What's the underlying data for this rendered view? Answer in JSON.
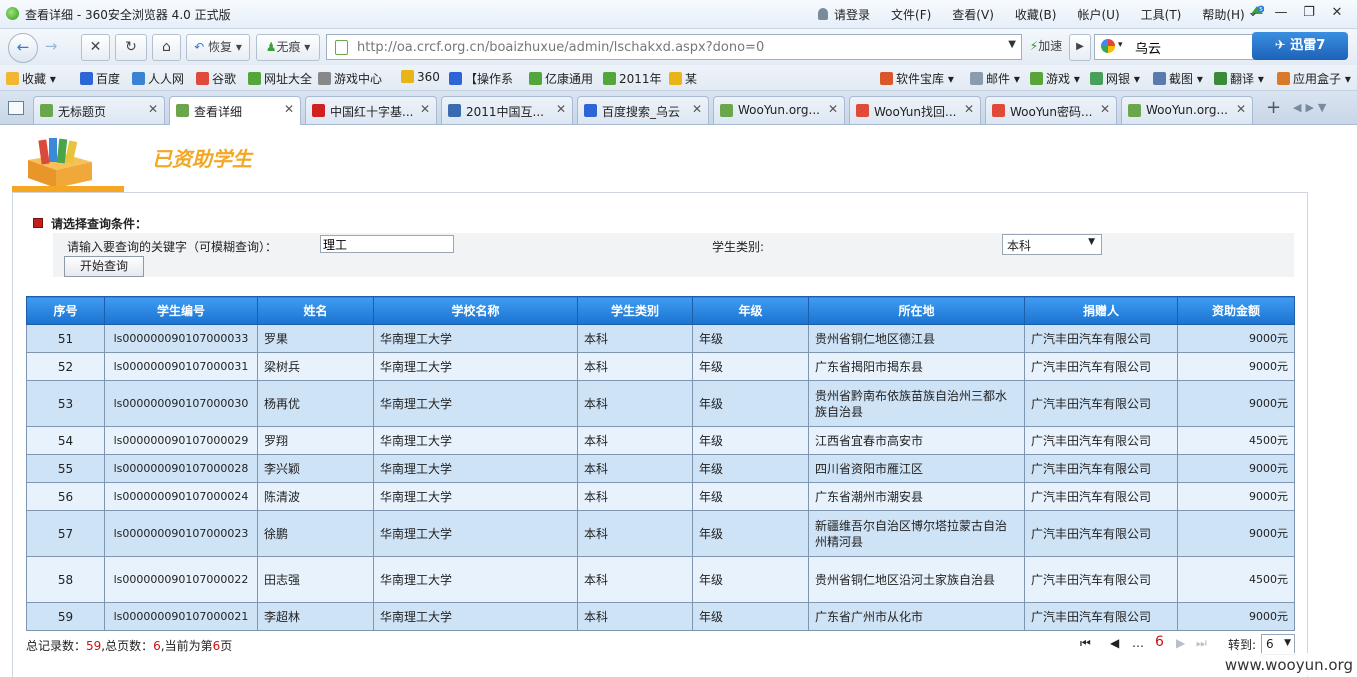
{
  "window": {
    "title": "查看详细 - 360安全浏览器 4.0 正式版",
    "menus": [
      "请登录",
      "文件(F)",
      "查看(V)",
      "收藏(B)",
      "帐户(U)",
      "工具(T)",
      "帮助(H)"
    ],
    "badge": "5"
  },
  "nav": {
    "back_icon": "back-arrow-icon",
    "restore_label": "恢复",
    "traceless_label": "无痕",
    "url": "http://oa.crcf.org.cn/boaizhuxue/admin/lschakxd.aspx?dono=0",
    "accelerate_label": "加速",
    "search_value": "乌云",
    "xunlei_label": "迅雷7"
  },
  "bookmarks": [
    {
      "label": "收藏 ▾",
      "color": "#f2b632"
    },
    {
      "label": "百度",
      "color": "#2d64d6"
    },
    {
      "label": "人人网",
      "color": "#3a83d4"
    },
    {
      "label": "谷歌",
      "color": "#e04a3a"
    },
    {
      "label": "网址大全",
      "color": "#53a53c"
    },
    {
      "label": "游戏中心",
      "color": "#888888"
    },
    {
      "label": "360",
      "color": "#e8b416"
    },
    {
      "label": "【操作系",
      "color": "#2d64d6"
    },
    {
      "label": "亿康通用",
      "color": "#53a53c"
    },
    {
      "label": "2011年",
      "color": "#53a53c"
    },
    {
      "label": "某",
      "color": "#e8b416"
    },
    {
      "label": "软件宝库 ▾",
      "color": "#d9572b"
    },
    {
      "label": "邮件 ▾",
      "color": "#8a9bb0"
    },
    {
      "label": "游戏 ▾",
      "color": "#5aa53a"
    },
    {
      "label": "网银 ▾",
      "color": "#4aa05a"
    },
    {
      "label": "截图 ▾",
      "color": "#5a7ab0"
    },
    {
      "label": "翻译 ▾",
      "color": "#3a8a3a"
    },
    {
      "label": "应用盒子 ▾",
      "color": "#d97a2b"
    }
  ],
  "tabs": [
    {
      "label": "无标题页",
      "color": "#6aa64b"
    },
    {
      "label": "查看详细",
      "color": "#6aa64b"
    },
    {
      "label": "中国红十字基...",
      "color": "#d02020"
    },
    {
      "label": "2011中国互...",
      "color": "#3a6ab0"
    },
    {
      "label": "百度搜索_乌云",
      "color": "#2d64d6"
    },
    {
      "label": "WooYun.org...",
      "color": "#6aa64b"
    },
    {
      "label": "WooYun找回...",
      "color": "#e04a3a"
    },
    {
      "label": "WooYun密码...",
      "color": "#e04a3a"
    },
    {
      "label": "WooYun.org...",
      "color": "#6aa64b"
    }
  ],
  "page": {
    "heading": "已资助学生",
    "filter_title": "请选择查询条件：",
    "keyword_label": "请输入要查询的关键字（可模糊查询）：",
    "keyword_value": "理工",
    "type_label": "学生类别:",
    "type_value": "本科",
    "search_button": "开始查询"
  },
  "table": {
    "headers": [
      "序号",
      "学生编号",
      "姓名",
      "学校名称",
      "学生类别",
      "年级",
      "所在地",
      "捐赠人",
      "资助金额"
    ],
    "rows": [
      [
        "51",
        "ls000000090107000033",
        "罗果",
        "华南理工大学",
        "本科",
        "年级",
        "贵州省铜仁地区德江县",
        "广汽丰田汽车有限公司",
        "9000元"
      ],
      [
        "52",
        "ls000000090107000031",
        "梁树兵",
        "华南理工大学",
        "本科",
        "年级",
        "广东省揭阳市揭东县",
        "广汽丰田汽车有限公司",
        "9000元"
      ],
      [
        "53",
        "ls000000090107000030",
        "杨再优",
        "华南理工大学",
        "本科",
        "年级",
        "贵州省黔南布依族苗族自治州三都水族自治县",
        "广汽丰田汽车有限公司",
        "9000元"
      ],
      [
        "54",
        "ls000000090107000029",
        "罗翔",
        "华南理工大学",
        "本科",
        "年级",
        "江西省宜春市高安市",
        "广汽丰田汽车有限公司",
        "4500元"
      ],
      [
        "55",
        "ls000000090107000028",
        "李兴颖",
        "华南理工大学",
        "本科",
        "年级",
        "四川省资阳市雁江区",
        "广汽丰田汽车有限公司",
        "9000元"
      ],
      [
        "56",
        "ls000000090107000024",
        "陈清波",
        "华南理工大学",
        "本科",
        "年级",
        "广东省潮州市潮安县",
        "广汽丰田汽车有限公司",
        "9000元"
      ],
      [
        "57",
        "ls000000090107000023",
        "徐鹏",
        "华南理工大学",
        "本科",
        "年级",
        "新疆维吾尔自治区博尔塔拉蒙古自治州精河县",
        "广汽丰田汽车有限公司",
        "9000元"
      ],
      [
        "58",
        "ls000000090107000022",
        "田志强",
        "华南理工大学",
        "本科",
        "年级",
        "贵州省铜仁地区沿河土家族自治县",
        "广汽丰田汽车有限公司",
        "4500元"
      ],
      [
        "59",
        "ls000000090107000021",
        "李超林",
        "华南理工大学",
        "本科",
        "年级",
        "广东省广州市从化市",
        "广汽丰田汽车有限公司",
        "9000元"
      ]
    ]
  },
  "footer": {
    "total_label": "总记录数：",
    "total": "59",
    "pages_label": ",总页数：",
    "pages": "6",
    "current_label": ",当前为第",
    "current": "6",
    "page_suffix": "页",
    "pager_current": "6",
    "goto_label": "转到:",
    "goto_value": "6"
  },
  "watermark": "www.wooyun.org"
}
